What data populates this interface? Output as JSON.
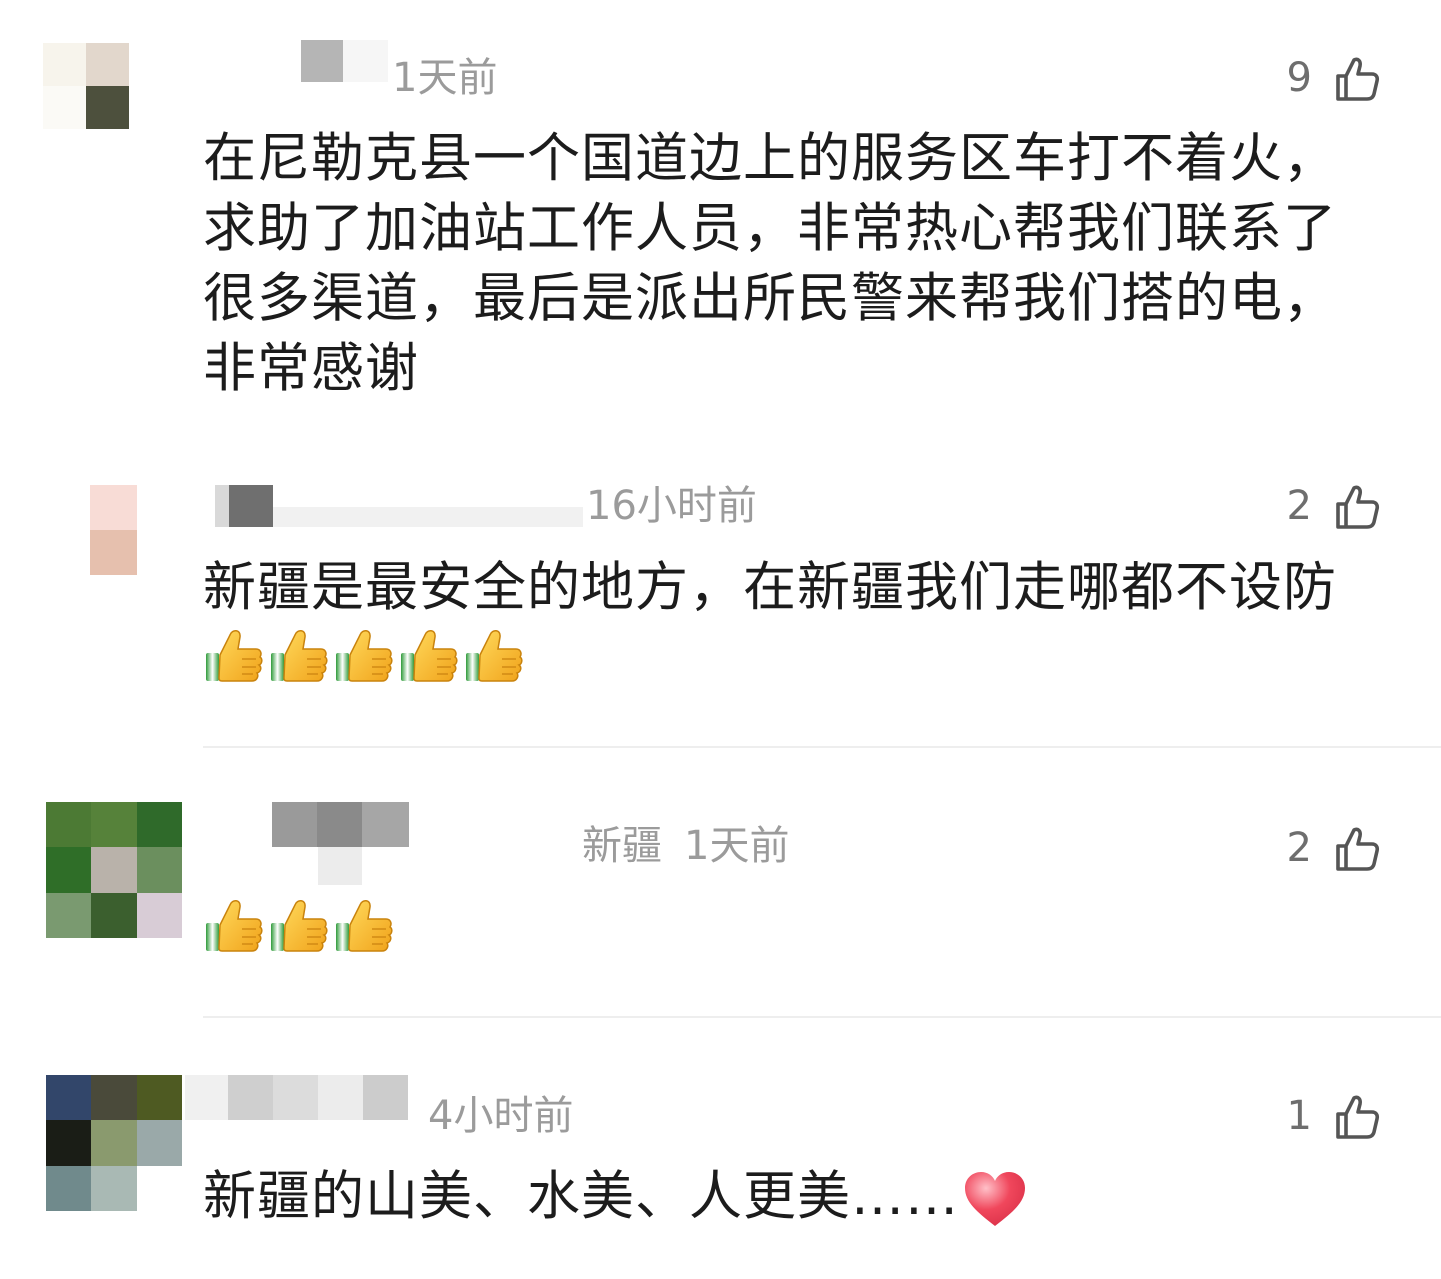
{
  "comments": [
    {
      "time": "1天前",
      "location": "",
      "likes": "9",
      "text": "在尼勒克县一个国道边上的服务区车打不着火，求助了加油站工作人员，非常热心帮我们联系了很多渠道，最后是派出所民警来帮我们搭的电，非常感谢",
      "emoji_icon": "",
      "emoji_count": 0
    },
    {
      "time": "16小时前",
      "location": "",
      "likes": "2",
      "text": "新疆是最安全的地方，在新疆我们走哪都不设防",
      "emoji_icon": "thumbs-up-emoji",
      "emoji_count": 5
    },
    {
      "time": "1天前",
      "location": "新疆",
      "likes": "2",
      "text": "",
      "emoji_icon": "thumbs-up-emoji",
      "emoji_count": 3
    },
    {
      "time": "4小时前",
      "location": "",
      "likes": "1",
      "text": "新疆的山美、水美、人更美……",
      "emoji_icon": "red-heart-emoji",
      "emoji_count": 0
    }
  ],
  "icons": {
    "like": "thumbs-up-outline-icon"
  },
  "colors": {
    "text": "#1c1c1c",
    "meta": "#9b9b9b",
    "like_count": "#6e6e6e",
    "divider": "#eeeeee",
    "heart": "#f0475c",
    "thumb": "#f7b425"
  }
}
